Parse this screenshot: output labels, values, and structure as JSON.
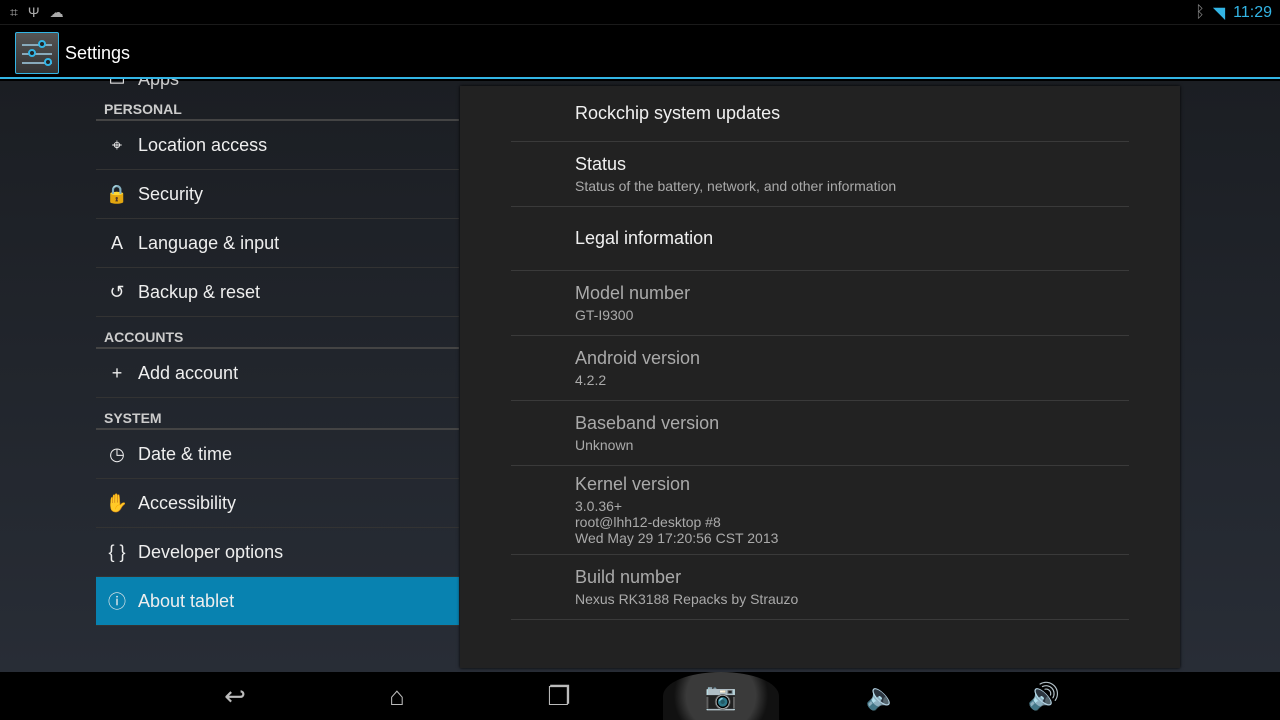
{
  "status": {
    "time": "11:29",
    "icons": [
      "debug-icon",
      "usb-icon",
      "android-icon"
    ],
    "right_icons": [
      "bluetooth-icon",
      "wifi-icon"
    ]
  },
  "action_bar": {
    "title": "Settings"
  },
  "sidebar": {
    "partial_item": "Apps",
    "sections": [
      {
        "header": "PERSONAL",
        "items": [
          {
            "label": "Location access",
            "icon": "⌖"
          },
          {
            "label": "Security",
            "icon": "🔒"
          },
          {
            "label": "Language & input",
            "icon": "A"
          },
          {
            "label": "Backup & reset",
            "icon": "↺"
          }
        ]
      },
      {
        "header": "ACCOUNTS",
        "items": [
          {
            "label": "Add account",
            "icon": "+"
          }
        ]
      },
      {
        "header": "SYSTEM",
        "items": [
          {
            "label": "Date & time",
            "icon": "◷"
          },
          {
            "label": "Accessibility",
            "icon": "✋"
          },
          {
            "label": "Developer options",
            "icon": "{ }"
          },
          {
            "label": "About tablet",
            "icon": "ⓘ",
            "selected": true
          }
        ]
      }
    ]
  },
  "panel": {
    "items": [
      {
        "title": "Rockchip system updates",
        "summary": ""
      },
      {
        "title": "Status",
        "summary": "Status of the battery, network, and other information"
      },
      {
        "title": "Legal information",
        "summary": ""
      },
      {
        "title": "Model number",
        "summary": "GT-I9300"
      },
      {
        "title": "Android version",
        "summary": "4.2.2"
      },
      {
        "title": "Baseband version",
        "summary": "Unknown"
      },
      {
        "title": "Kernel version",
        "summary": "3.0.36+\nroot@lhh12-desktop #8\nWed May 29 17:20:56 CST 2013"
      },
      {
        "title": "Build number",
        "summary": "Nexus RK3188 Repacks by Strauzo"
      }
    ]
  },
  "nav": [
    "back",
    "home",
    "recents",
    "screenshot",
    "volume-down",
    "volume-up"
  ],
  "colors": {
    "accent": "#33b5e5",
    "selected": "#0882b0"
  }
}
